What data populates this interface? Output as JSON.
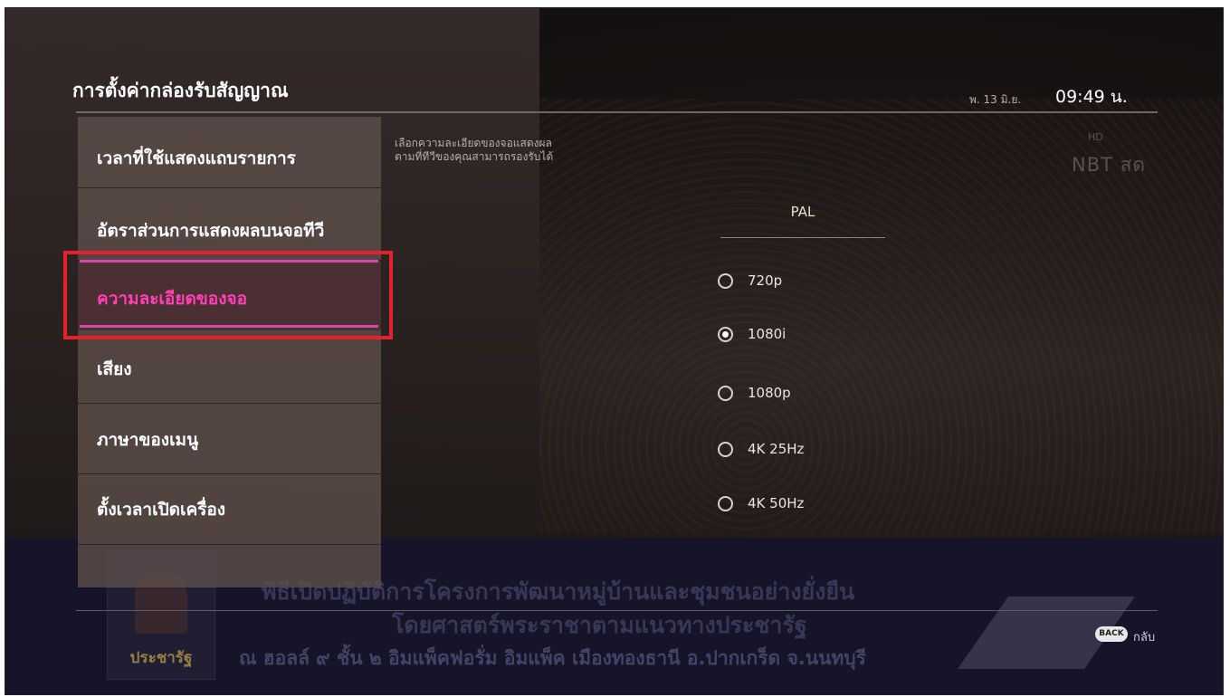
{
  "header": {
    "title": "การตั้งค่ากล่องรับสัญญาณ",
    "date": "พ. 13 มิ.ย.",
    "time": "09:49 น."
  },
  "menu": {
    "items": [
      {
        "label": "เวลาที่ใช้แสดงแถบรายการ",
        "active": false
      },
      {
        "label": "อัตราส่วนการแสดงผลบนจอทีวี",
        "active": false
      },
      {
        "label": "ความละเอียดของจอ",
        "active": true
      },
      {
        "label": "เสียง",
        "active": false
      },
      {
        "label": "ภาษาของเมนู",
        "active": false
      },
      {
        "label": "ตั้งเวลาเปิดเครื่อง",
        "active": false
      }
    ]
  },
  "panel": {
    "description_line1": "เลือกความละเอียดของจอแสดงผล",
    "description_line2": "ตามที่ทีวีของคุณสามารถรองรับได้",
    "standard": "PAL",
    "options": [
      {
        "label": "720p",
        "selected": false
      },
      {
        "label": "1080i",
        "selected": true
      },
      {
        "label": "1080p",
        "selected": false
      },
      {
        "label": "4K 25Hz",
        "selected": false
      },
      {
        "label": "4K 50Hz",
        "selected": false
      }
    ]
  },
  "channel_logo": "NBT สด",
  "background_banner": {
    "line1": "พิธีเปิดปฏิบัติการโครงการพัฒนาหมู่บ้านและชุมชนอย่างยั่งยืน",
    "line2": "โดยศาสตร์พระราชาตามแนวทางประชารัฐ",
    "line3": "ณ ฮอลล์ ๙  ชั้น ๒ อิมแพ็คฟอรั่ม อิมแพ็ค เมืองทองธานี อ.ปากเกร็ด จ.นนทบุรี",
    "logo_text": "ประชารัฐ"
  },
  "footer": {
    "back_button": "BACK",
    "back_label": "กลับ"
  },
  "colors": {
    "accent_pink": "#ff3fb6",
    "highlight_red": "#e6202c"
  }
}
